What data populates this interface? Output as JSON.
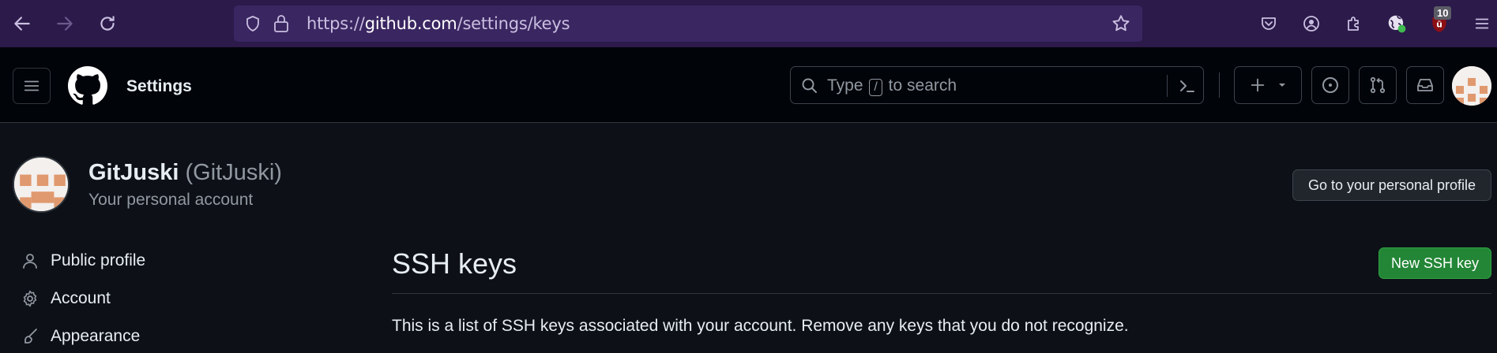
{
  "browser": {
    "url_scheme": "https://",
    "url_host": "github.com",
    "url_path": "/settings/keys",
    "extension_badge": "10"
  },
  "header": {
    "title": "Settings",
    "search_prefix": "Type",
    "search_key": "/",
    "search_suffix": "to search"
  },
  "profile": {
    "name": "GitJuski",
    "login": "(GitJuski)",
    "subtitle": "Your personal account",
    "profile_button": "Go to your personal profile"
  },
  "sidebar": {
    "items": [
      {
        "label": "Public profile",
        "icon": "person-icon"
      },
      {
        "label": "Account",
        "icon": "gear-icon"
      },
      {
        "label": "Appearance",
        "icon": "paintbrush-icon"
      }
    ]
  },
  "main": {
    "title": "SSH keys",
    "new_button": "New SSH key",
    "description": "This is a list of SSH keys associated with your account. Remove any keys that you do not recognize."
  },
  "colors": {
    "page_bg": "#0d1117",
    "header_bg": "#010409",
    "browser_bg": "#2b1a4a",
    "primary_button": "#238636",
    "avatar_accent": "#e0996e"
  }
}
